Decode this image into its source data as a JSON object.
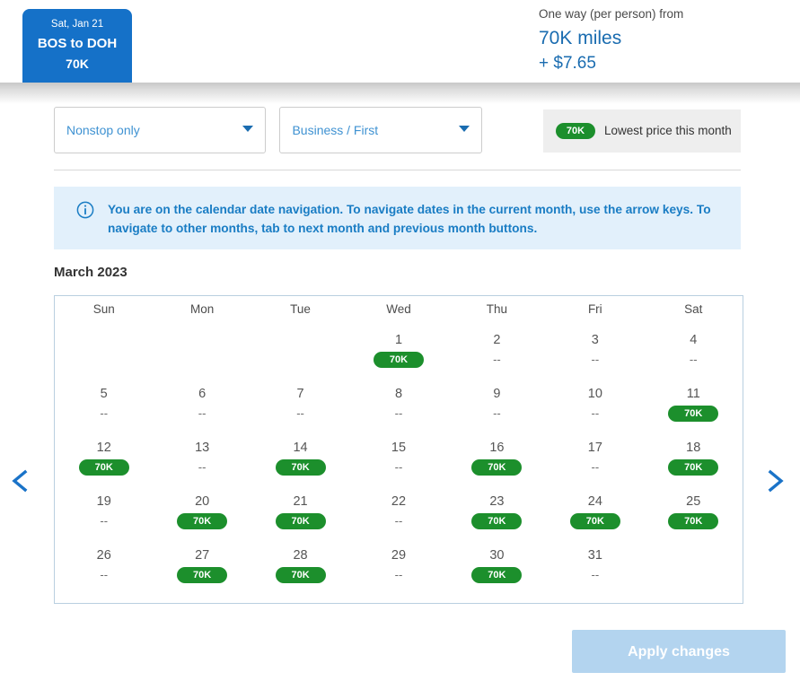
{
  "header": {
    "flight_tab": {
      "date": "Sat, Jan 21",
      "route": "BOS to DOH",
      "miles": "70K"
    },
    "price": {
      "label": "One way (per person) from",
      "miles": "70K miles",
      "fee": "+ $7.65"
    }
  },
  "filters": {
    "stops_select": "Nonstop only",
    "cabin_select": "Business / First",
    "legend": {
      "badge": "70K",
      "text": "Lowest price this month"
    }
  },
  "info_banner": {
    "icon": "info-circle-icon",
    "message": "You are on the calendar date navigation. To navigate dates in the current month, use the arrow keys. To navigate to other months, tab to next month and previous month buttons."
  },
  "calendar": {
    "month_title": "March 2023",
    "weekday_headers": [
      "Sun",
      "Mon",
      "Tue",
      "Wed",
      "Thu",
      "Fri",
      "Sat"
    ],
    "weeks": [
      [
        {
          "day": "",
          "value": ""
        },
        {
          "day": "",
          "value": ""
        },
        {
          "day": "",
          "value": ""
        },
        {
          "day": "1",
          "value": "70K",
          "available": true
        },
        {
          "day": "2",
          "value": "--",
          "available": false
        },
        {
          "day": "3",
          "value": "--",
          "available": false
        },
        {
          "day": "4",
          "value": "--",
          "available": false
        }
      ],
      [
        {
          "day": "5",
          "value": "--",
          "available": false
        },
        {
          "day": "6",
          "value": "--",
          "available": false
        },
        {
          "day": "7",
          "value": "--",
          "available": false
        },
        {
          "day": "8",
          "value": "--",
          "available": false
        },
        {
          "day": "9",
          "value": "--",
          "available": false
        },
        {
          "day": "10",
          "value": "--",
          "available": false
        },
        {
          "day": "11",
          "value": "70K",
          "available": true
        }
      ],
      [
        {
          "day": "12",
          "value": "70K",
          "available": true
        },
        {
          "day": "13",
          "value": "--",
          "available": false
        },
        {
          "day": "14",
          "value": "70K",
          "available": true
        },
        {
          "day": "15",
          "value": "--",
          "available": false
        },
        {
          "day": "16",
          "value": "70K",
          "available": true
        },
        {
          "day": "17",
          "value": "--",
          "available": false
        },
        {
          "day": "18",
          "value": "70K",
          "available": true
        }
      ],
      [
        {
          "day": "19",
          "value": "--",
          "available": false
        },
        {
          "day": "20",
          "value": "70K",
          "available": true
        },
        {
          "day": "21",
          "value": "70K",
          "available": true
        },
        {
          "day": "22",
          "value": "--",
          "available": false
        },
        {
          "day": "23",
          "value": "70K",
          "available": true
        },
        {
          "day": "24",
          "value": "70K",
          "available": true
        },
        {
          "day": "25",
          "value": "70K",
          "available": true
        }
      ],
      [
        {
          "day": "26",
          "value": "--",
          "available": false
        },
        {
          "day": "27",
          "value": "70K",
          "available": true
        },
        {
          "day": "28",
          "value": "70K",
          "available": true
        },
        {
          "day": "29",
          "value": "--",
          "available": false
        },
        {
          "day": "30",
          "value": "70K",
          "available": true
        },
        {
          "day": "31",
          "value": "--",
          "available": false
        }
      ]
    ]
  },
  "navigation": {
    "prev_icon": "chevron-left-icon",
    "next_icon": "chevron-right-icon"
  },
  "footer": {
    "apply_label": "Apply changes"
  },
  "colors": {
    "brand_blue": "#1571c8",
    "link_blue": "#1a6cb0",
    "badge_green": "#1c8f2c",
    "banner_blue": "#e2f0fb",
    "apply_disabled": "#b3d4ef"
  }
}
